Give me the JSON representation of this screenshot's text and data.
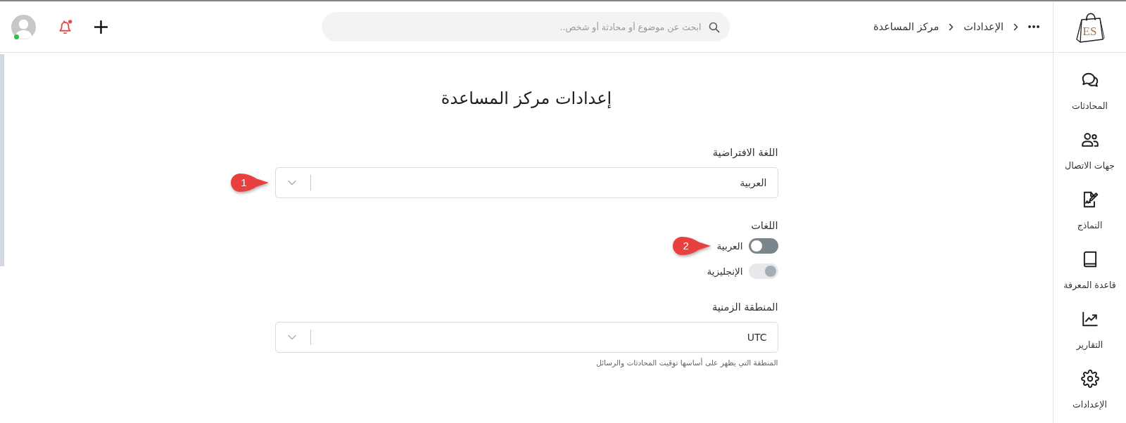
{
  "logo": {
    "text": "ES"
  },
  "breadcrumb": [
    {
      "label": "الإعدادات"
    },
    {
      "label": "مركز المساعدة"
    }
  ],
  "search": {
    "placeholder": "ابحث عن موضوع أو محادثة أو شخص.."
  },
  "notifications": {
    "unread": true
  },
  "user": {
    "online": true
  },
  "sidebar": {
    "items": [
      {
        "label": "المحادثات",
        "selected": false
      },
      {
        "label": "جهات الاتصال",
        "selected": false
      },
      {
        "label": "النماذج",
        "selected": false
      },
      {
        "label": "قاعدة المعرفة",
        "selected": false
      },
      {
        "label": "التقارير",
        "selected": false
      },
      {
        "label": "الإعدادات",
        "selected": false
      }
    ]
  },
  "page": {
    "title": "إعدادات مركز المساعدة"
  },
  "fields": [
    {
      "kind": "select",
      "label": "اللغة الافتراضية",
      "value": "العربية",
      "callout": "1"
    },
    {
      "kind": "toggles",
      "label": "اللغات",
      "options": [
        {
          "label": "العربية",
          "on": false,
          "disabled": false,
          "callout": "2"
        },
        {
          "label": "الإنجليزية",
          "on": true,
          "disabled": true
        }
      ]
    },
    {
      "kind": "select",
      "label": "المنطقة الزمنية",
      "value": "UTC",
      "hint": "المنطقة التي يظهر على أساسها توقيت المحادثات والرسائل"
    }
  ]
}
